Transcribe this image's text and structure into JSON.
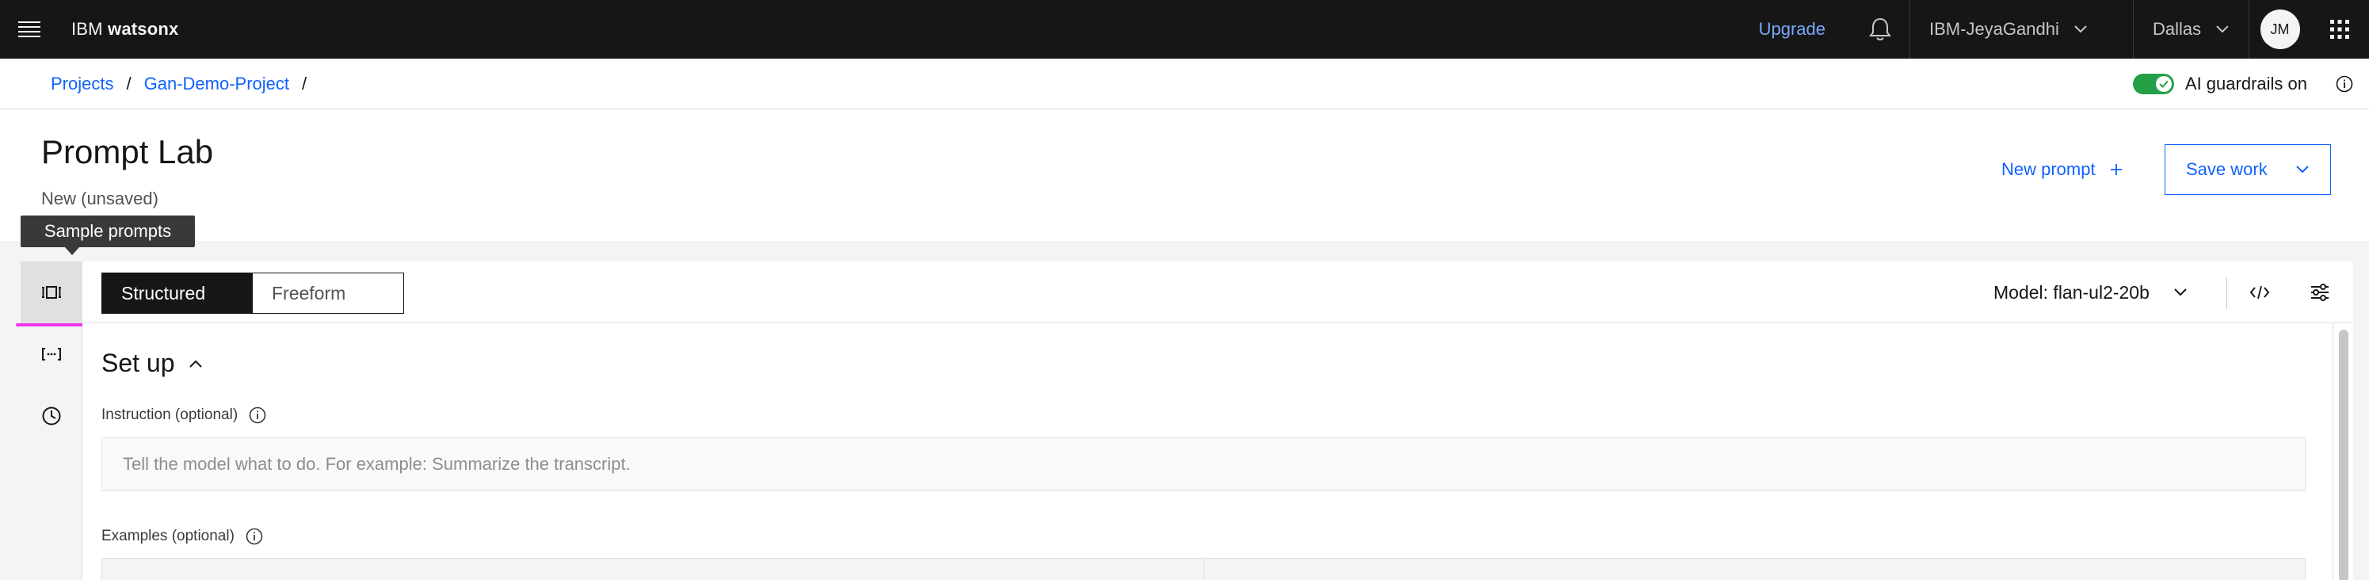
{
  "header": {
    "brand_prefix": "IBM",
    "brand_product": "watsonx",
    "upgrade_label": "Upgrade",
    "account": "IBM-JeyaGandhi",
    "region": "Dallas",
    "avatar_initials": "JM"
  },
  "breadcrumb": {
    "items": [
      "Projects",
      "Gan-Demo-Project"
    ],
    "separator": "/"
  },
  "guardrails": {
    "label": "AI guardrails on",
    "enabled": true
  },
  "page": {
    "title": "Prompt Lab",
    "subtitle": "New (unsaved)",
    "new_prompt_label": "New prompt",
    "save_work_label": "Save work"
  },
  "tooltip": {
    "text": "Sample prompts"
  },
  "mode_switch": {
    "options": [
      "Structured",
      "Freeform"
    ],
    "selected": "Structured"
  },
  "model": {
    "label": "Model: flan-ul2-20b"
  },
  "setup": {
    "heading": "Set up",
    "instruction_label": "Instruction (optional)",
    "instruction_placeholder": "Tell the model what to do. For example: Summarize the transcript.",
    "examples_label": "Examples (optional)"
  },
  "colors": {
    "header_bg": "#161616",
    "link": "#0f62fe",
    "upgrade": "#78a9ff",
    "toggle_on": "#24a148",
    "highlight": "#ee36ee"
  },
  "icons": [
    "menu-icon",
    "notification-icon",
    "chevron-down-icon",
    "app-switcher-icon",
    "checkmark-icon",
    "info-icon",
    "add-icon",
    "sample-prompts-icon",
    "variables-icon",
    "history-icon",
    "code-icon",
    "settings-adjust-icon",
    "chevron-up-icon"
  ]
}
